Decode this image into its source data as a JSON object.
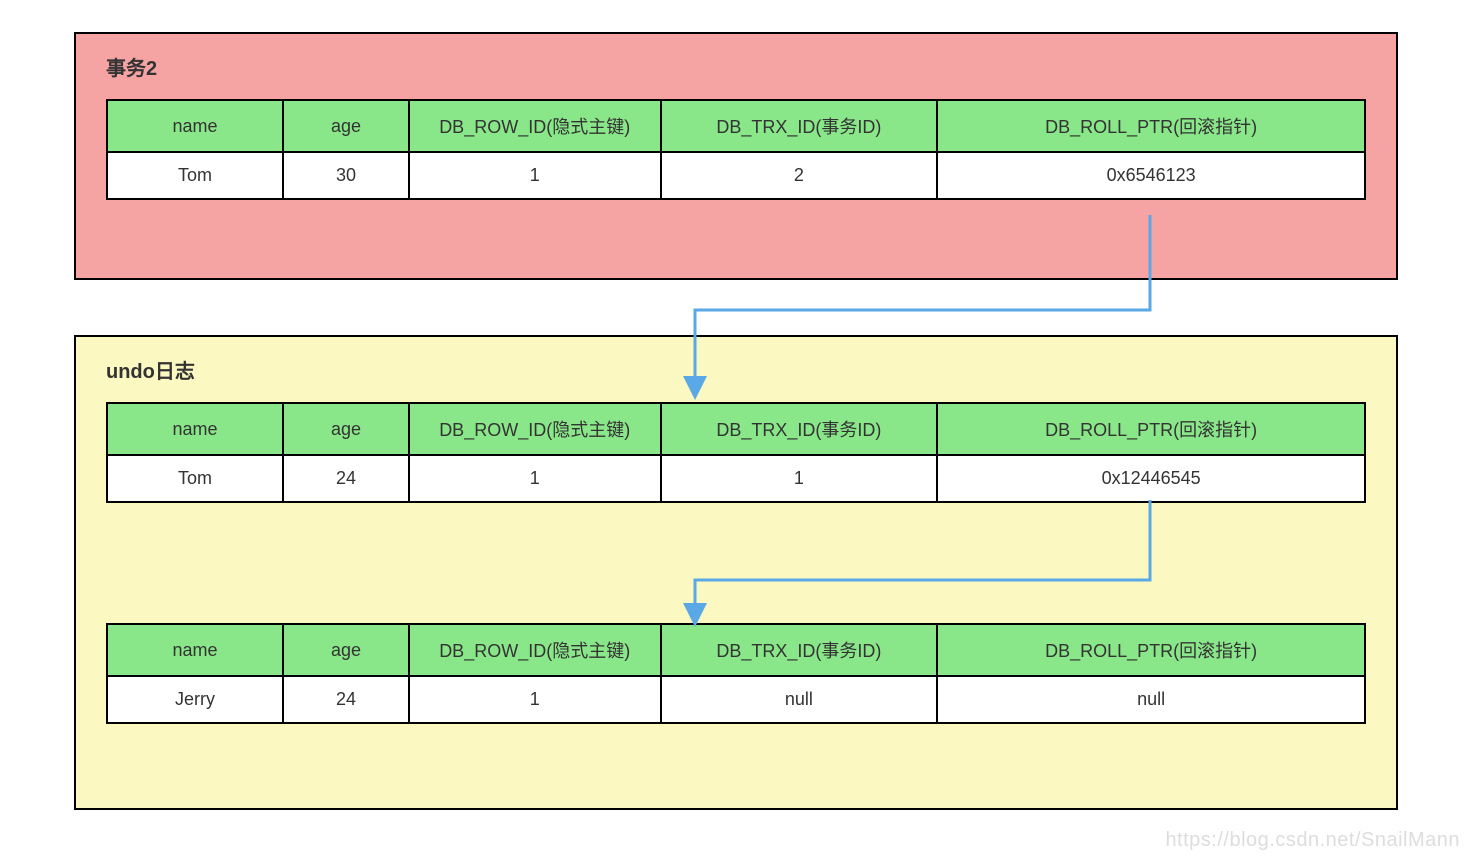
{
  "panels": {
    "tx2": {
      "title": "事务2"
    },
    "undo": {
      "title": "undo日志"
    }
  },
  "columns": {
    "name": "name",
    "age": "age",
    "row_id": "DB_ROW_ID(隐式主键)",
    "trx_id": "DB_TRX_ID(事务ID)",
    "roll_ptr": "DB_ROLL_PTR(回滚指针)"
  },
  "records": {
    "current": {
      "name": "Tom",
      "age": "30",
      "row_id": "1",
      "trx_id": "2",
      "roll_ptr": "0x6546123"
    },
    "undo1": {
      "name": "Tom",
      "age": "24",
      "row_id": "1",
      "trx_id": "1",
      "roll_ptr": "0x12446545"
    },
    "undo2": {
      "name": "Jerry",
      "age": "24",
      "row_id": "1",
      "trx_id": "null",
      "roll_ptr": "null"
    }
  },
  "arrows": {
    "color": "#5aa9e6"
  },
  "watermark": "https://blog.csdn.net/SnailMann"
}
